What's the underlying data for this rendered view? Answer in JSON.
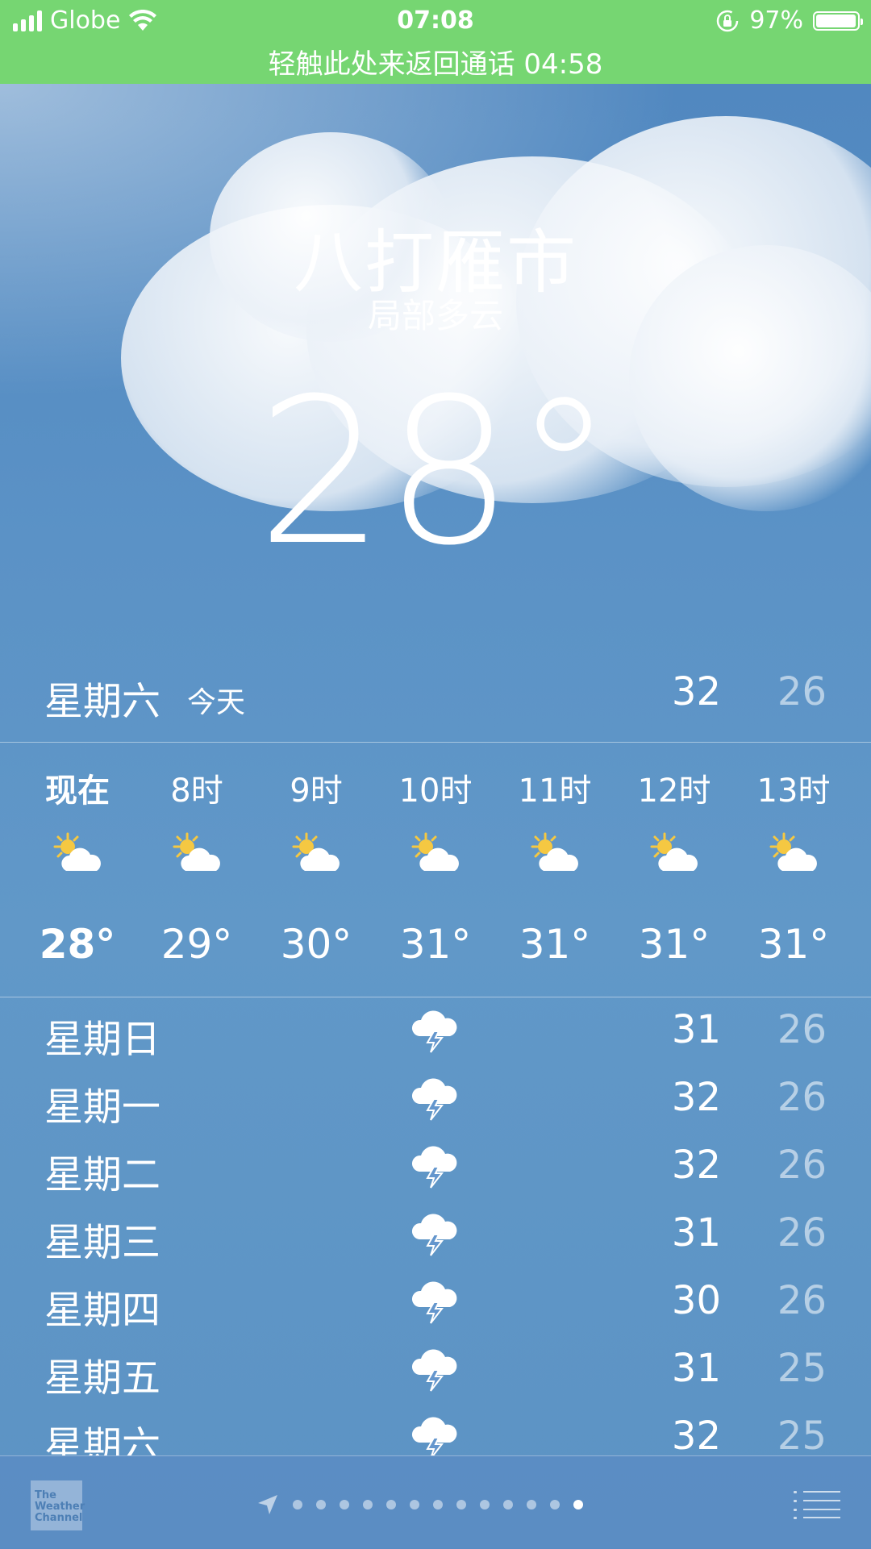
{
  "status_bar": {
    "carrier": "Globe",
    "time": "07:08",
    "battery": "97%",
    "battery_level": 0.97,
    "call_banner": "轻触此处来返回通话 04:58"
  },
  "header": {
    "city": "八打雁市",
    "condition": "局部多云",
    "temperature": "28°"
  },
  "today": {
    "day": "星期六",
    "tag": "今天",
    "high": "32",
    "low": "26"
  },
  "hourly": [
    {
      "time": "现在",
      "icon": "partly-sunny-icon",
      "temp": "28°"
    },
    {
      "time": "8时",
      "icon": "partly-sunny-icon",
      "temp": "29°"
    },
    {
      "time": "9时",
      "icon": "partly-sunny-icon",
      "temp": "30°"
    },
    {
      "time": "10时",
      "icon": "partly-sunny-icon",
      "temp": "31°"
    },
    {
      "time": "11时",
      "icon": "partly-sunny-icon",
      "temp": "31°"
    },
    {
      "time": "12时",
      "icon": "partly-sunny-icon",
      "temp": "31°"
    },
    {
      "time": "13时",
      "icon": "partly-sunny-icon",
      "temp": "31°"
    }
  ],
  "daily": [
    {
      "day": "星期日",
      "icon": "thunderstorm-icon",
      "high": "31",
      "low": "26"
    },
    {
      "day": "星期一",
      "icon": "thunderstorm-icon",
      "high": "32",
      "low": "26"
    },
    {
      "day": "星期二",
      "icon": "thunderstorm-icon",
      "high": "32",
      "low": "26"
    },
    {
      "day": "星期三",
      "icon": "thunderstorm-icon",
      "high": "31",
      "low": "26"
    },
    {
      "day": "星期四",
      "icon": "thunderstorm-icon",
      "high": "30",
      "low": "26"
    },
    {
      "day": "星期五",
      "icon": "thunderstorm-icon",
      "high": "31",
      "low": "25"
    },
    {
      "day": "星期六",
      "icon": "thunderstorm-icon",
      "high": "32",
      "low": "25"
    }
  ],
  "toolbar": {
    "logo_text": [
      "The",
      "Weather",
      "Channel"
    ],
    "page_count": 13,
    "active_page": 13
  },
  "colors": {
    "status_bar": "#76d672",
    "sky": "#5b92c6",
    "sun": "#f5c842"
  }
}
